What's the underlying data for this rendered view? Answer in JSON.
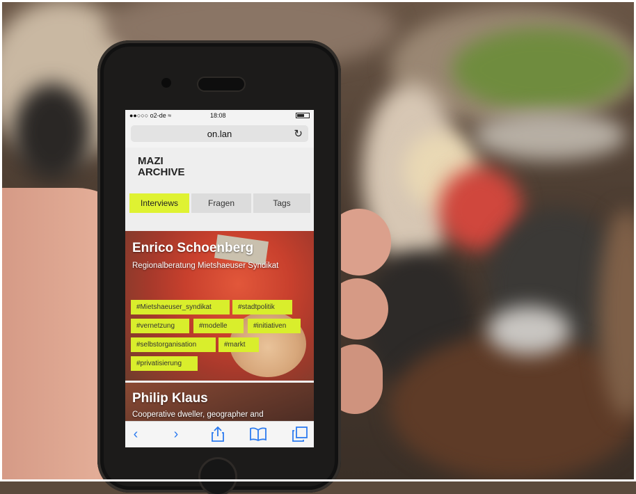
{
  "status_bar": {
    "carrier": "●●○○○ o2-de ≈",
    "time": "18:08"
  },
  "browser": {
    "url": "on.lan",
    "reload_icon": "reload-icon"
  },
  "site": {
    "brand_line1": "MAZI",
    "brand_line2": "ARCHIVE",
    "tabs": [
      {
        "label": "Interviews",
        "active": true
      },
      {
        "label": "Fragen",
        "active": false
      },
      {
        "label": "Tags",
        "active": false
      }
    ]
  },
  "cards": [
    {
      "name": "Enrico Schoenberg",
      "subtitle": "Regionalberatung Mietshaeuser Syndikat",
      "tags": [
        "#Mietshaeuser_syndikat",
        "#stadtpolitik",
        "#vernetzung",
        "#modelle",
        "#initiativen",
        "#selbstorganisation",
        "#markt",
        "#privatisierung"
      ]
    },
    {
      "name": "Philip Klaus",
      "subtitle": "Cooperative dweller, geographer and"
    }
  ],
  "toolbar": {
    "back": "‹",
    "forward": "›",
    "share_icon": "share-icon",
    "bookmarks_icon": "bookmarks-icon",
    "tabs_icon": "tabs-icon"
  },
  "colors": {
    "accent": "#dff232",
    "tag": "#d9ee2c",
    "toolbar_blue": "#2c7bf0"
  }
}
